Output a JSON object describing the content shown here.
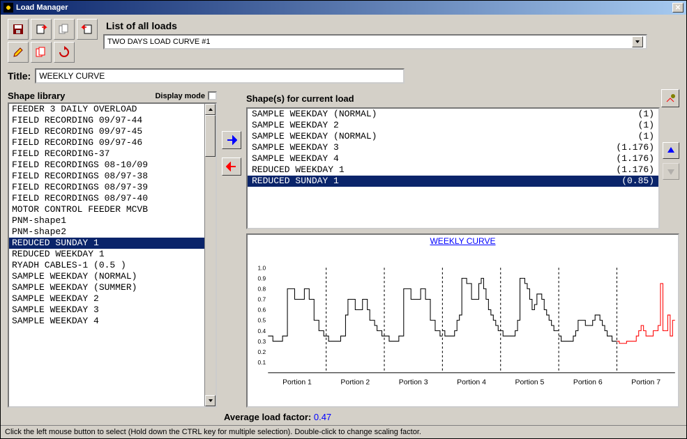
{
  "window": {
    "title": "Load Manager"
  },
  "toolbar": {
    "icons": [
      "save",
      "import",
      "copy-doc",
      "export",
      "edit",
      "docs",
      "refresh"
    ]
  },
  "list_of_loads": {
    "label": "List of all loads",
    "selected": "TWO DAYS LOAD CURVE #1"
  },
  "title_field": {
    "label": "Title:",
    "value": "WEEKLY CURVE"
  },
  "shape_library": {
    "label": "Shape library",
    "display_mode_label": "Display mode",
    "items": [
      "FEEDER 3  DAILY OVERLOAD",
      "FIELD RECORDING 09/97-44",
      "FIELD RECORDING 09/97-45",
      "FIELD RECORDING 09/97-46",
      "FIELD RECORDING-37",
      "FIELD RECORDINGS 08-10/09",
      "FIELD RECORDINGS 08/97-38",
      "FIELD RECORDINGS 08/97-39",
      "FIELD RECORDINGS 08/97-40",
      "MOTOR CONTROL FEEDER MCVB",
      "PNM-shape1",
      "PNM-shape2",
      "REDUCED SUNDAY 1",
      "REDUCED WEEKDAY 1",
      "RYADH CABLES-1 (0.5 )",
      "SAMPLE WEEKDAY (NORMAL)",
      "SAMPLE WEEKDAY (SUMMER)",
      "SAMPLE WEEKDAY 2",
      "SAMPLE WEEKDAY 3",
      "SAMPLE WEEKDAY 4"
    ],
    "selected_index": 12
  },
  "shapes_for_load": {
    "label": "Shape(s)  for current load",
    "items": [
      {
        "name": "SAMPLE WEEKDAY (NORMAL)",
        "factor": "(1)"
      },
      {
        "name": "SAMPLE WEEKDAY 2",
        "factor": "(1)"
      },
      {
        "name": "SAMPLE WEEKDAY (NORMAL)",
        "factor": "(1)"
      },
      {
        "name": "SAMPLE WEEKDAY 3",
        "factor": "(1.176)"
      },
      {
        "name": "SAMPLE WEEKDAY 4",
        "factor": "(1.176)"
      },
      {
        "name": "REDUCED WEEKDAY 1",
        "factor": "(1.176)"
      },
      {
        "name": "REDUCED SUNDAY 1",
        "factor": "(0.85)"
      }
    ],
    "selected_index": 6
  },
  "chart_data": {
    "type": "line",
    "title": "WEEKLY CURVE",
    "ylim": [
      0,
      1.0
    ],
    "yticks": [
      0.1,
      0.2,
      0.3,
      0.4,
      0.5,
      0.6,
      0.7,
      0.8,
      0.9,
      1.0
    ],
    "portions": [
      "Portion 1",
      "Portion 2",
      "Portion 3",
      "Portion 4",
      "Portion 5",
      "Portion 6",
      "Portion 7"
    ],
    "last_portion_red": true,
    "series": [
      {
        "portion": 1,
        "values": [
          0.35,
          0.35,
          0.3,
          0.3,
          0.3,
          0.3,
          0.35,
          0.35,
          0.8,
          0.8,
          0.8,
          0.7,
          0.7,
          0.7,
          0.7,
          0.8,
          0.8,
          0.7,
          0.7,
          0.5,
          0.5,
          0.4,
          0.4,
          0.35
        ]
      },
      {
        "portion": 2,
        "values": [
          0.35,
          0.3,
          0.3,
          0.3,
          0.3,
          0.3,
          0.35,
          0.35,
          0.55,
          0.7,
          0.7,
          0.7,
          0.6,
          0.6,
          0.6,
          0.7,
          0.7,
          0.6,
          0.5,
          0.5,
          0.45,
          0.4,
          0.4,
          0.35
        ]
      },
      {
        "portion": 3,
        "values": [
          0.35,
          0.35,
          0.3,
          0.3,
          0.3,
          0.3,
          0.35,
          0.35,
          0.8,
          0.8,
          0.8,
          0.7,
          0.7,
          0.7,
          0.7,
          0.8,
          0.8,
          0.7,
          0.7,
          0.5,
          0.5,
          0.4,
          0.4,
          0.35
        ]
      },
      {
        "portion": 4,
        "values": [
          0.4,
          0.35,
          0.35,
          0.35,
          0.35,
          0.4,
          0.5,
          0.55,
          0.9,
          0.9,
          0.85,
          0.85,
          0.7,
          0.7,
          0.7,
          0.85,
          0.9,
          0.8,
          0.7,
          0.6,
          0.55,
          0.5,
          0.45,
          0.4
        ]
      },
      {
        "portion": 5,
        "values": [
          0.4,
          0.35,
          0.35,
          0.35,
          0.35,
          0.35,
          0.4,
          0.5,
          0.9,
          0.9,
          0.85,
          0.8,
          0.7,
          0.6,
          0.65,
          0.75,
          0.75,
          0.7,
          0.6,
          0.55,
          0.5,
          0.45,
          0.4,
          0.4
        ]
      },
      {
        "portion": 6,
        "values": [
          0.35,
          0.3,
          0.3,
          0.3,
          0.3,
          0.3,
          0.35,
          0.4,
          0.5,
          0.5,
          0.5,
          0.45,
          0.45,
          0.45,
          0.5,
          0.55,
          0.55,
          0.5,
          0.45,
          0.4,
          0.35,
          0.35,
          0.3,
          0.3
        ]
      },
      {
        "portion": 7,
        "values": [
          0.3,
          0.28,
          0.28,
          0.28,
          0.3,
          0.3,
          0.3,
          0.3,
          0.35,
          0.4,
          0.45,
          0.4,
          0.35,
          0.35,
          0.35,
          0.4,
          0.4,
          0.45,
          0.85,
          0.4,
          0.4,
          0.55,
          0.35,
          0.5
        ]
      }
    ]
  },
  "avg_load": {
    "label": "Average load factor:",
    "value": "0.47"
  },
  "status": "Click the left mouse button to select (Hold down the CTRL key for multiple selection). Double-click to change scaling factor."
}
